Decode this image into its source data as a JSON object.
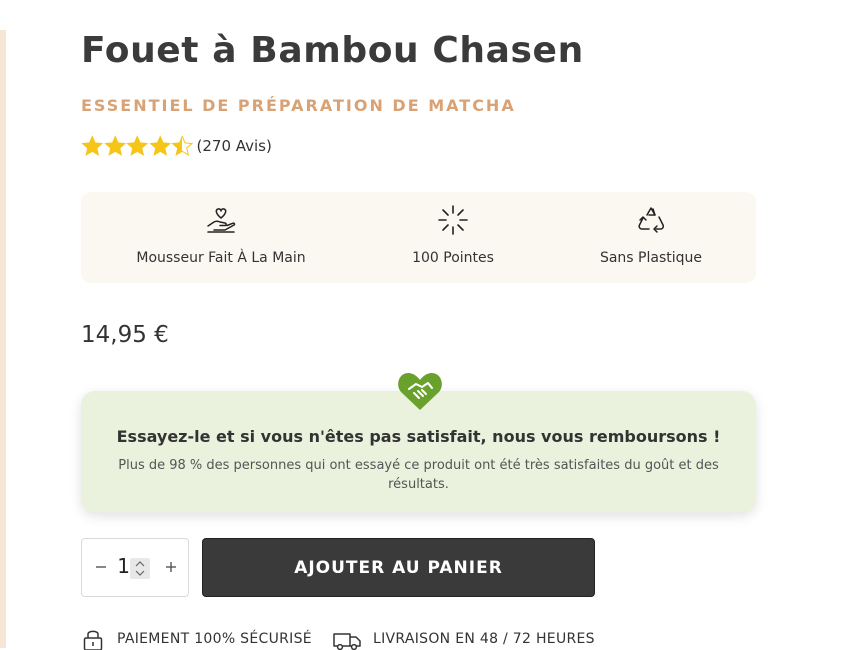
{
  "product": {
    "title": "Fouet à Bambou Chasen",
    "subtitle": "ESSENTIEL DE PRÉPARATION DE MATCHA",
    "rating_value": 4.5,
    "rating_max": 5,
    "reviews": "(270 Avis)",
    "price": "14,95 €",
    "star_color": "#f5c518"
  },
  "features": [
    {
      "icon": "heart-in-hand-icon",
      "label": "Mousseur Fait À La Main"
    },
    {
      "icon": "burst-lines-icon",
      "label": "100 Pointes"
    },
    {
      "icon": "recycle-icon",
      "label": "Sans Plastique"
    }
  ],
  "guarantee": {
    "icon": "handshake-heart-icon",
    "title": "Essayez-le et si vous n'êtes pas satisfait, nous vous remboursons !",
    "text": "Plus de 98 % des personnes qui ont essayé ce produit ont été très satisfaites du goût et des résultats.",
    "accent": "#6aa12c",
    "background": "#eaf1dd"
  },
  "purchase": {
    "quantity": "1",
    "add_to_cart": "AJOUTER AU PANIER",
    "button_color": "#3a3a3a"
  },
  "trust": [
    {
      "icon": "padlock-icon",
      "label": "PAIEMENT 100% SÉCURISÉ"
    },
    {
      "icon": "delivery-truck-icon",
      "label": "LIVRAISON EN 48 / 72 HEURES"
    }
  ]
}
